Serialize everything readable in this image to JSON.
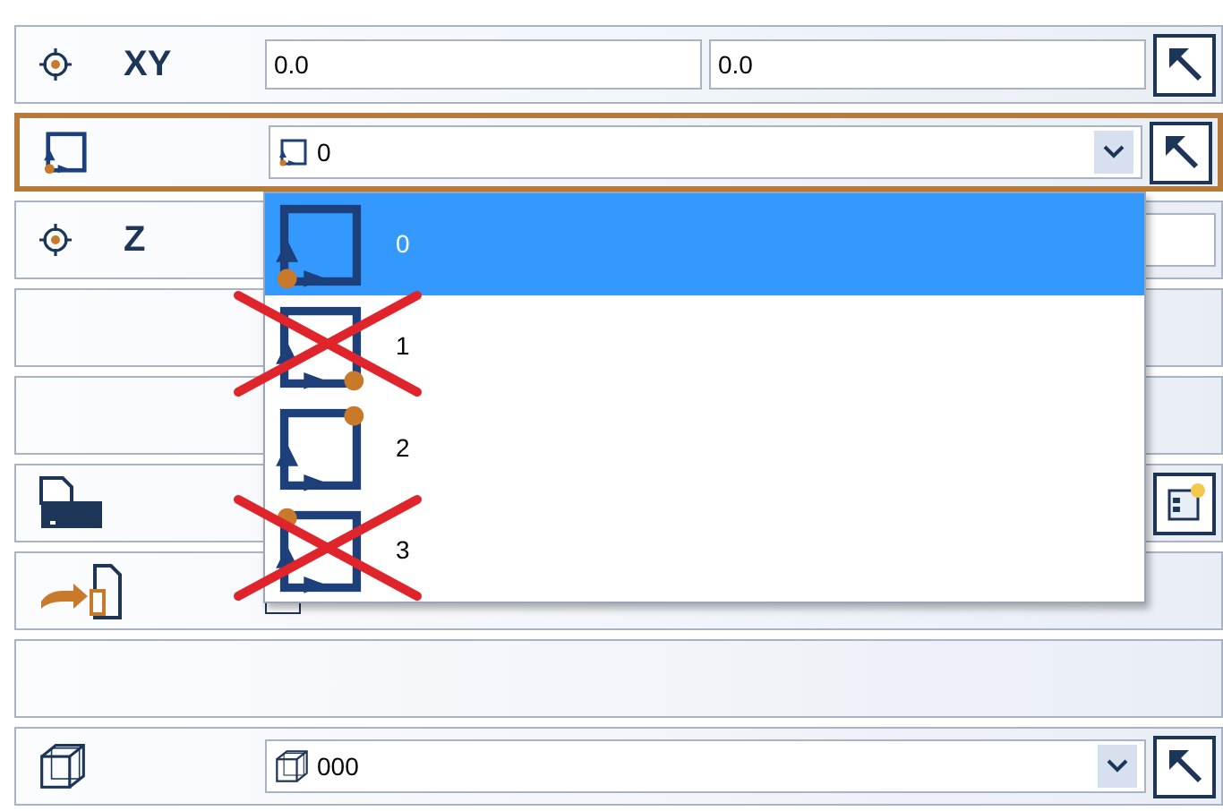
{
  "rows": [
    {
      "kind": "xy",
      "label": "XY",
      "values": [
        "0.0",
        "0.0"
      ]
    },
    {
      "kind": "path-select",
      "highlighted": true,
      "value": "0"
    },
    {
      "kind": "z",
      "label": "Z"
    },
    {
      "kind": "empty"
    },
    {
      "kind": "empty"
    },
    {
      "kind": "abc"
    },
    {
      "kind": "arrow"
    },
    {
      "kind": "empty"
    },
    {
      "kind": "cube-select",
      "highlighted": false,
      "value": "000"
    }
  ],
  "dropdown": {
    "items": [
      {
        "label": "0",
        "selected": true,
        "crossed": false
      },
      {
        "label": "1",
        "selected": false,
        "crossed": true
      },
      {
        "label": "2",
        "selected": false,
        "crossed": false
      },
      {
        "label": "3",
        "selected": false,
        "crossed": true
      }
    ]
  }
}
